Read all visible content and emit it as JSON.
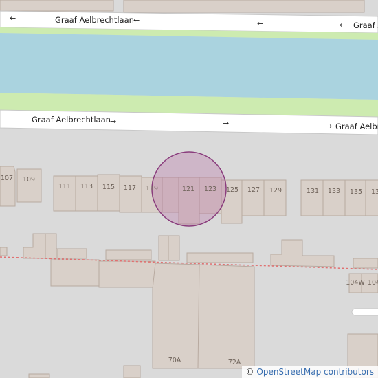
{
  "map": {
    "colors": {
      "background": "#dadada",
      "road": "#ffffff",
      "road_casing": "#c8c8c8",
      "grass": "#cdebb0",
      "water": "#aad3df",
      "building": "#d9d0c9",
      "building_outline": "#b8aaa0",
      "boundary_dashed": "#e07070",
      "highlight_fill": "#b05a9a",
      "highlight_stroke": "#8a3d7d"
    },
    "street_labels": [
      {
        "text": "Graaf Aelbrechtlaan",
        "arrow": "←"
      },
      {
        "text": "Graaf A",
        "arrow": "←"
      },
      {
        "text": "Graaf Aelbrechtlaan",
        "arrow": "→"
      },
      {
        "text": "Graaf Aelbre",
        "arrow": "→"
      }
    ],
    "oneway_arrows": {
      "top": "←",
      "bottom": "→"
    },
    "house_numbers": {
      "n107": "107",
      "n109": "109",
      "n111": "111",
      "n113": "113",
      "n115": "115",
      "n117": "117",
      "n119": "119",
      "n121": "121",
      "n123": "123",
      "n125": "125",
      "n127": "127",
      "n129": "129",
      "n131": "131",
      "n133": "133",
      "n135": "135",
      "n13x": "13",
      "n104w": "104W",
      "n104x": "104",
      "n70a": "70A",
      "n72a": "72A"
    }
  },
  "attribution": {
    "copyright": "©",
    "text": "OpenStreetMap contributors"
  }
}
